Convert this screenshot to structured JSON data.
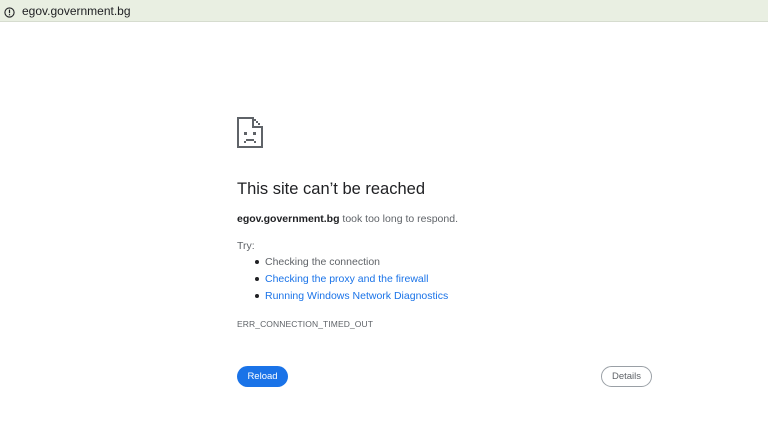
{
  "address_bar": {
    "url": "egov.government.bg",
    "icon": "info-icon"
  },
  "error": {
    "icon": "sad-document-icon",
    "title": "This site can’t be reached",
    "host": "egov.government.bg",
    "message": " took too long to respond.",
    "try_label": "Try:",
    "suggestions": [
      {
        "label": "Checking the connection",
        "is_link": false
      },
      {
        "label": "Checking the proxy and the firewall",
        "is_link": true
      },
      {
        "label": "Running Windows Network Diagnostics",
        "is_link": true
      }
    ],
    "code": "ERR_CONNECTION_TIMED_OUT"
  },
  "buttons": {
    "reload_label": "Reload",
    "details_label": "Details"
  },
  "colors": {
    "accent": "#1a73e8",
    "address_bar_bg": "#e9efe2",
    "text_primary": "#202124",
    "text_secondary": "#5f6368"
  }
}
